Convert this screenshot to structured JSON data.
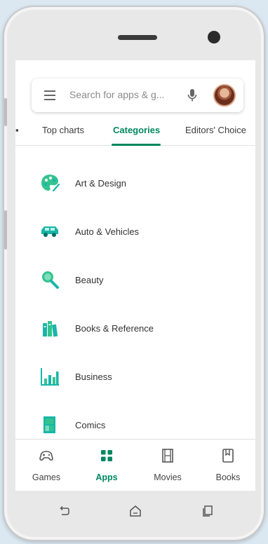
{
  "search": {
    "placeholder": "Search for apps & g..."
  },
  "tabs": [
    {
      "label": "Top charts",
      "active": false
    },
    {
      "label": "Categories",
      "active": true
    },
    {
      "label": "Editors' Choice",
      "active": false
    }
  ],
  "categories": [
    {
      "label": "Art & Design",
      "icon": "palette-icon"
    },
    {
      "label": "Auto & Vehicles",
      "icon": "car-icon"
    },
    {
      "label": "Beauty",
      "icon": "magnifier-beauty-icon"
    },
    {
      "label": "Books & Reference",
      "icon": "books-icon"
    },
    {
      "label": "Business",
      "icon": "bar-chart-icon"
    },
    {
      "label": "Comics",
      "icon": "comics-icon"
    }
  ],
  "bottom_nav": [
    {
      "label": "Games",
      "icon": "gamepad-icon",
      "active": false
    },
    {
      "label": "Apps",
      "icon": "apps-grid-icon",
      "active": true
    },
    {
      "label": "Movies",
      "icon": "film-icon",
      "active": false
    },
    {
      "label": "Books",
      "icon": "bookmark-book-icon",
      "active": false
    }
  ],
  "system_nav": [
    {
      "icon": "back-icon"
    },
    {
      "icon": "home-icon"
    },
    {
      "icon": "recents-icon"
    }
  ],
  "colors": {
    "accent": "#01875f",
    "icon_teal": "#17b6a8",
    "icon_green": "#34c38f",
    "background": "#dbe8f2"
  }
}
